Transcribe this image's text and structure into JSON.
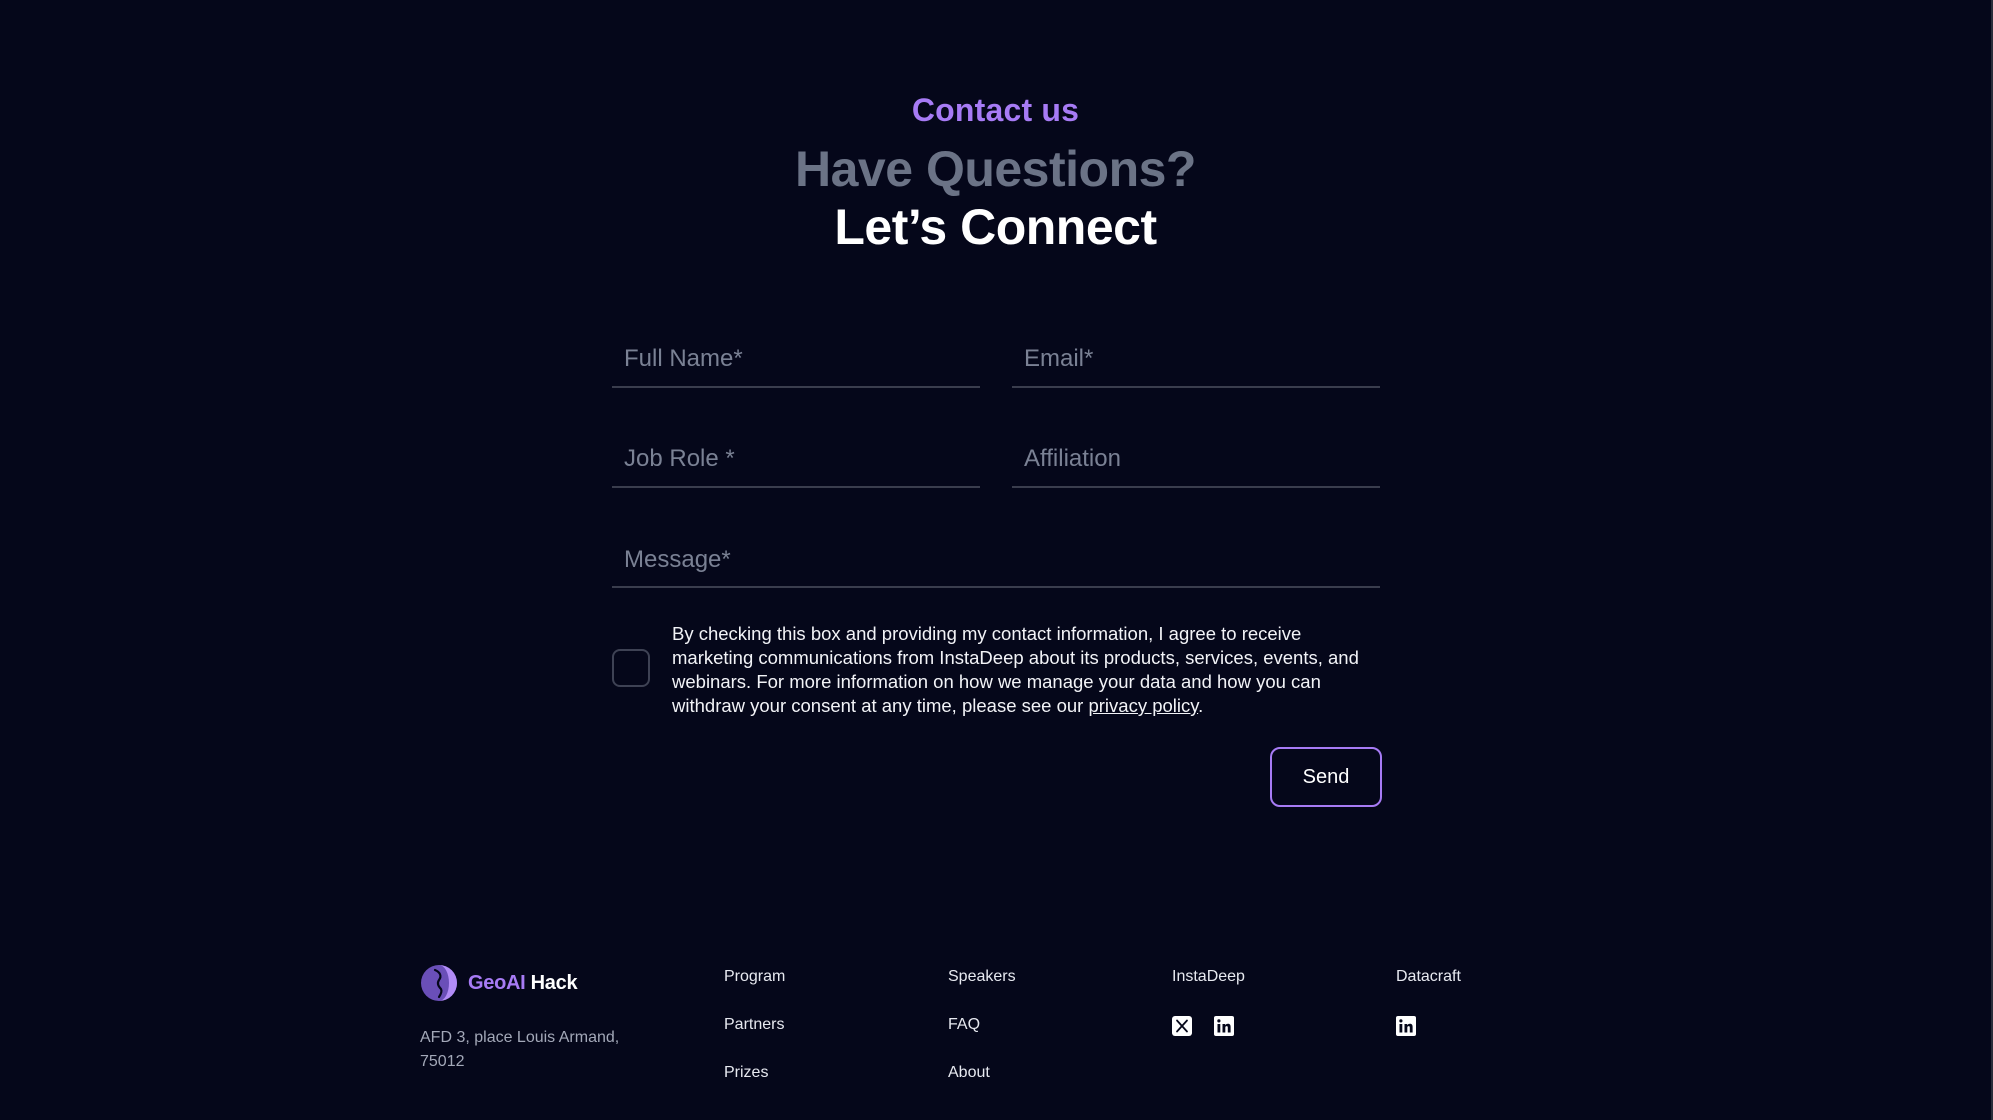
{
  "header": {
    "eyebrow": "Contact us",
    "title_line1": "Have Questions?",
    "title_line2": "Let’s Connect"
  },
  "form": {
    "full_name": {
      "placeholder": "Full Name*",
      "value": ""
    },
    "email": {
      "placeholder": "Email*",
      "value": ""
    },
    "job_role": {
      "placeholder": "Job Role *",
      "value": ""
    },
    "affiliation": {
      "placeholder": "Affiliation",
      "value": ""
    },
    "message": {
      "placeholder": "Message*",
      "value": ""
    },
    "consent": {
      "checked": false,
      "text_before": "By checking this box and providing my contact information, I agree to receive marketing communications from InstaDeep about its products, services, events, and webinars. For more information on how we manage your data and how you can withdraw your consent at any time, please see our ",
      "link_label": "privacy policy",
      "text_after": "."
    },
    "send_label": "Send"
  },
  "footer": {
    "brand": {
      "name_accent": "GeoAI",
      "name_rest": " Hack"
    },
    "address": "AFD 3, place Louis Armand, 75012",
    "col1": [
      "Program",
      "Partners",
      "Prizes"
    ],
    "col2": [
      "Speakers",
      "FAQ",
      "About"
    ],
    "col3": {
      "title": "InstaDeep",
      "icons": [
        "x-twitter-icon",
        "linkedin-icon"
      ]
    },
    "col4": {
      "title": "Datacraft",
      "icons": [
        "linkedin-icon"
      ]
    }
  },
  "colors": {
    "background": "#05071a",
    "accent": "#a77bf5",
    "muted_heading": "#6b7386"
  }
}
